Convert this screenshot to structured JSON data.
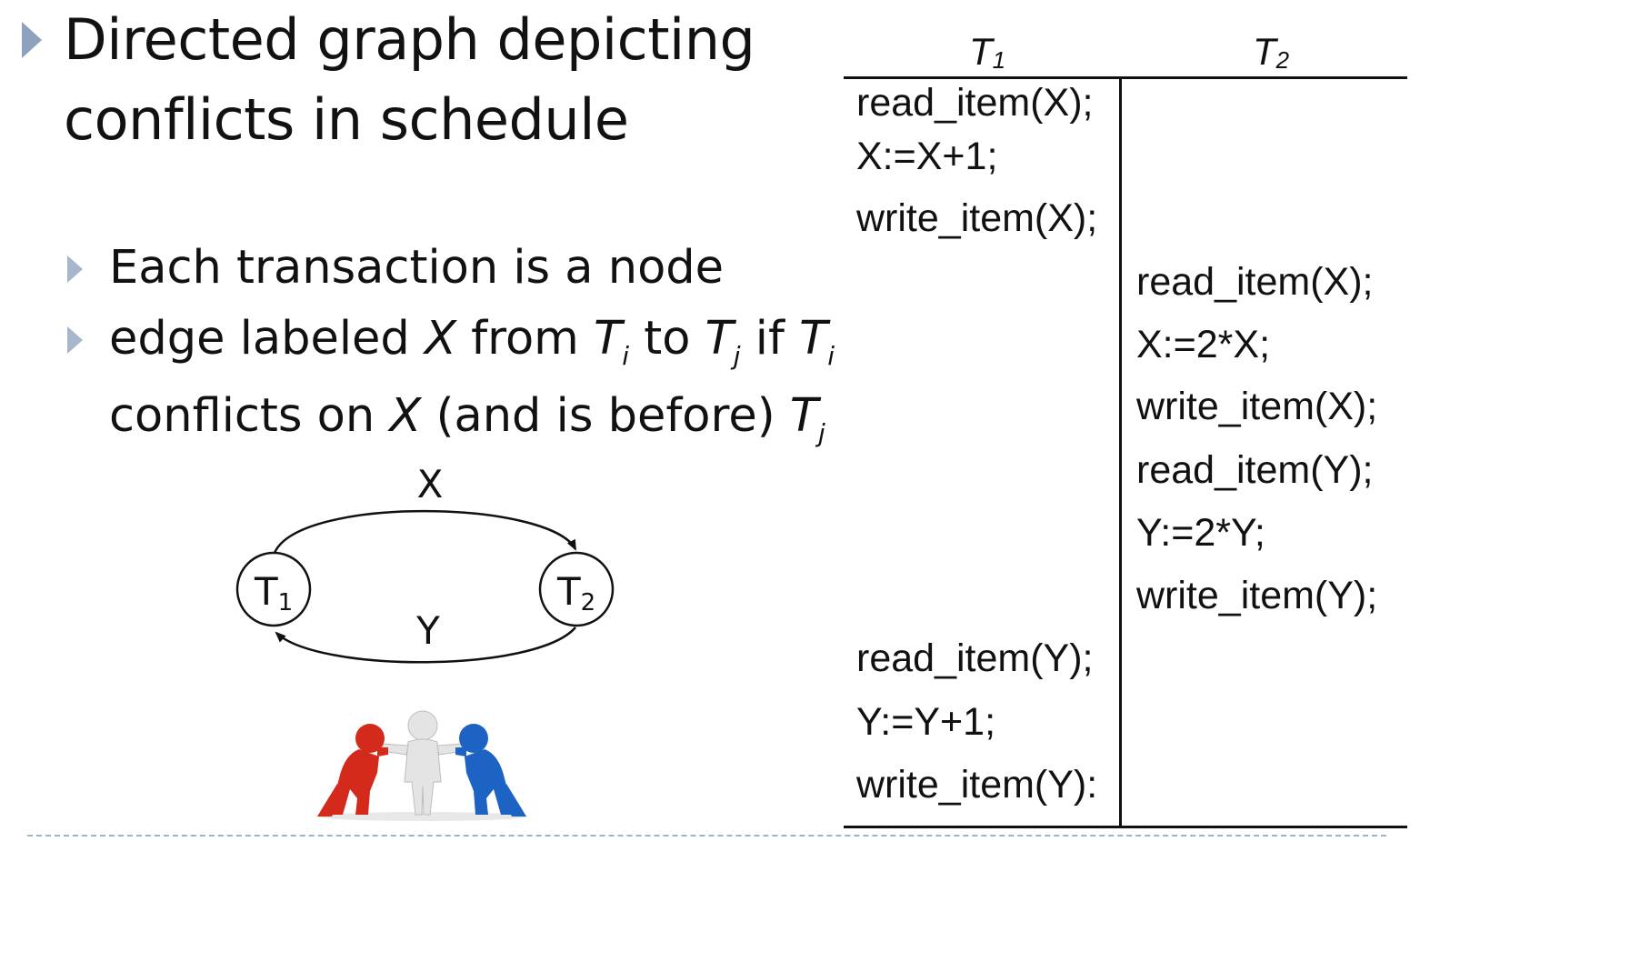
{
  "slide": {
    "title_line1": "Directed graph depicting",
    "title_line2": "conflicts in schedule",
    "bullets": [
      {
        "text": "Each transaction is a node"
      },
      {
        "line1_a": "edge labeled ",
        "line1_x": "X",
        "line1_b": " from ",
        "Ti_base": "T",
        "i_sub": "i",
        "line1_c": " to ",
        "Tj_base": "T",
        "j_sub": "j",
        "line1_d": " if ",
        "line2_a": "conflicts on ",
        "line2_x": "X",
        "line2_b": " (and is before) "
      }
    ]
  },
  "graph": {
    "node1_label": "T",
    "node1_sub": "1",
    "node2_label": "T",
    "node2_sub": "2",
    "edge_x_label": "X",
    "edge_y_label": "Y"
  },
  "schedule": {
    "headers": [
      {
        "base": "T",
        "sub": "1"
      },
      {
        "base": "T",
        "sub": "2"
      }
    ],
    "t1_ops_top": [
      "read_item(X);",
      "X:=X+1;",
      "write_item(X);"
    ],
    "t2_ops": [
      "read_item(X);",
      "X:=2*X;",
      "write_item(X);",
      "read_item(Y);",
      "Y:=2*Y;",
      "write_item(Y);"
    ],
    "t1_ops_bottom": [
      "read_item(Y);",
      "Y:=Y+1;",
      "write_item(Y):"
    ]
  },
  "colors": {
    "bullet_l1": "#8ea1bd",
    "bullet_l2": "#a7b6cc",
    "figure_red": "#d42a1c",
    "figure_blue": "#1d63c4",
    "figure_white": "#e4e4e4",
    "footer_dash": "#9fb3c8"
  }
}
